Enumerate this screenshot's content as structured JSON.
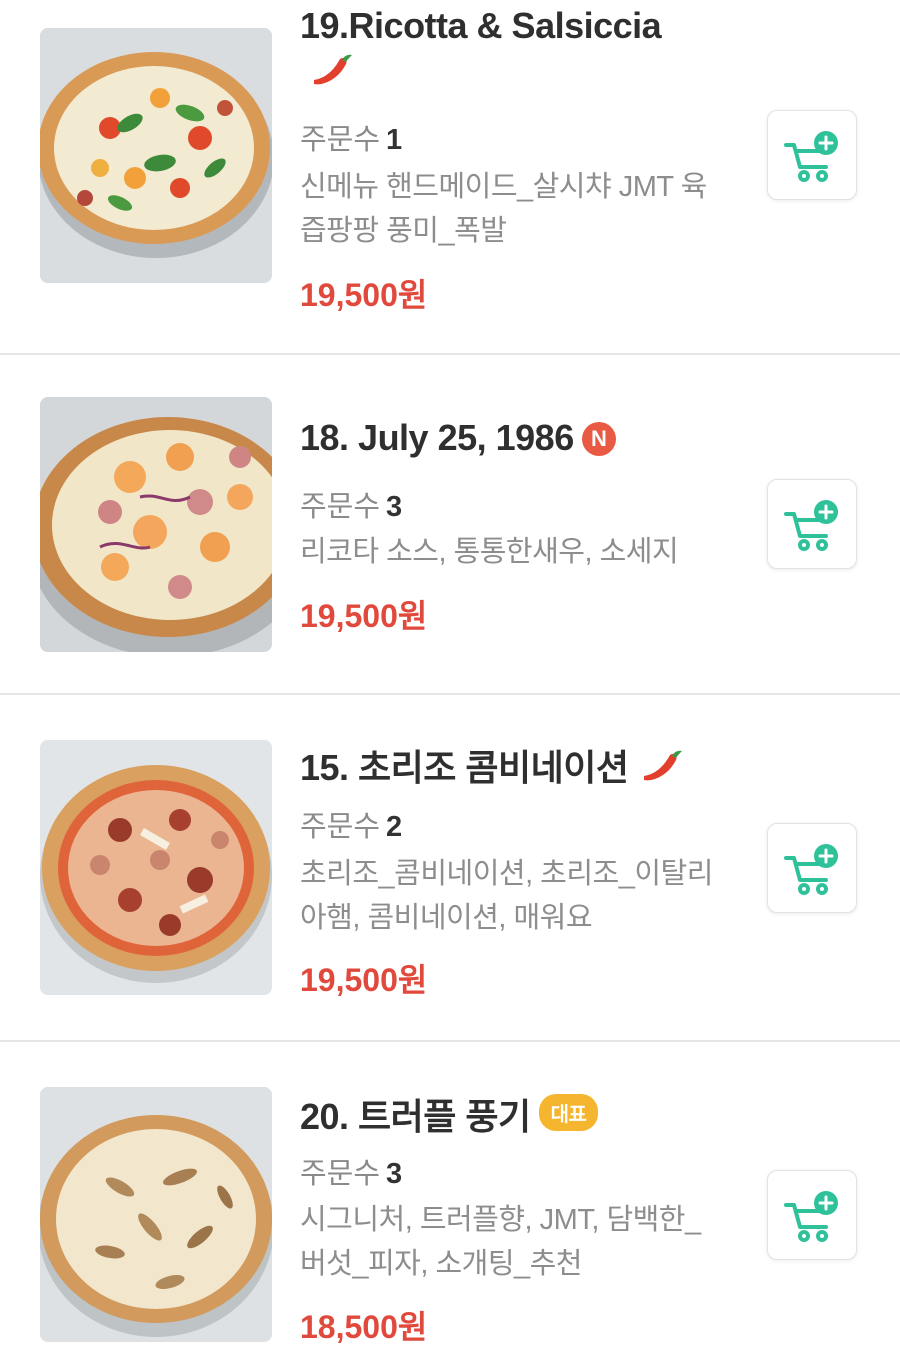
{
  "menu": {
    "order_label": "주문수",
    "items": [
      {
        "name": "19.Ricotta & Salsiccia",
        "badge_icon": "chili-pepper-icon",
        "order_count": "1",
        "desc": "신메뉴 핸드메이드_살시챠 JMT 육즙팡팡 풍미_폭발",
        "price": "19,500원",
        "image": "pizza-photo-ricotta-salsiccia"
      },
      {
        "name": "18. July 25, 1986",
        "badge_text": "N",
        "order_count": "3",
        "desc": "리코타 소스, 통통한새우, 소세지",
        "price": "19,500원",
        "image": "pizza-photo-shrimp-sausage"
      },
      {
        "name": "15. 초리조 콤비네이션",
        "badge_icon": "chili-pepper-icon",
        "order_count": "2",
        "desc": "초리조_콤비네이션, 초리조_이탈리아햄, 콤비네이션, 매워요",
        "price": "19,500원",
        "image": "pizza-photo-chorizo"
      },
      {
        "name": "20. 트러플 풍기",
        "badge_text": "대표",
        "order_count": "3",
        "desc": "시그니처, 트러플향, JMT, 담백한_버섯_피자, 소개팅_추천",
        "price": "18,500원",
        "image": "pizza-photo-truffle-funghi"
      }
    ]
  },
  "colors": {
    "price": "#e0493b",
    "cart_icon": "#2fc29a",
    "new_badge": "#e95a45",
    "rep_badge": "#f5b52f"
  }
}
